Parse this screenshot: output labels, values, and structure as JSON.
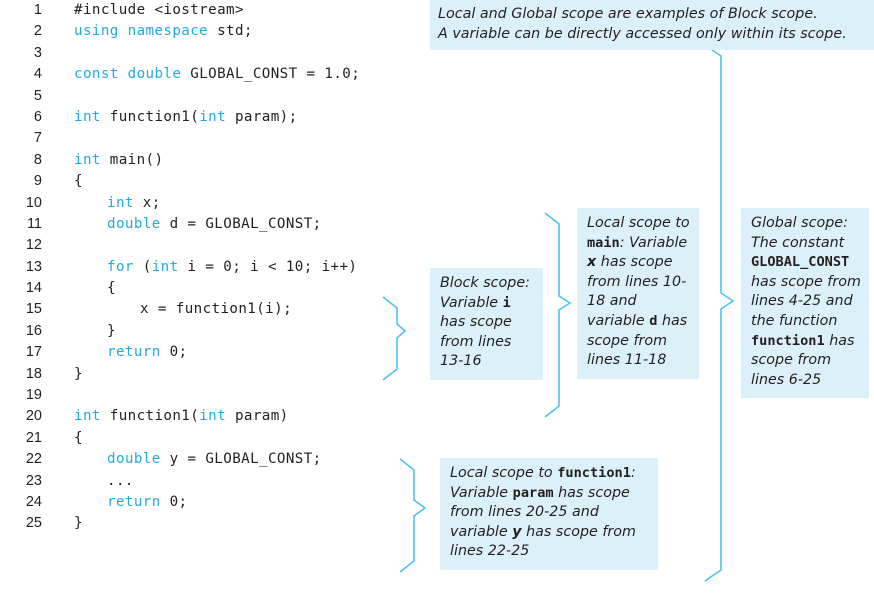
{
  "figure": {
    "type": "annotated-code-listing",
    "language": "C++",
    "background_color": "#ffffff",
    "keyword_color": "#22abe3",
    "text_color": "#231f20",
    "callout_background": "#dcf0fa",
    "connector_color": "#4cc3ef"
  },
  "code": {
    "lines": [
      {
        "number": "1",
        "tokens": [
          {
            "t": "#include <iostream>",
            "k": false
          }
        ],
        "indent": 0
      },
      {
        "number": "2",
        "tokens": [
          {
            "t": "using namespace",
            "k": true
          },
          {
            "t": " std;",
            "k": false
          }
        ],
        "indent": 0
      },
      {
        "number": "3",
        "tokens": [],
        "indent": 0
      },
      {
        "number": "4",
        "tokens": [
          {
            "t": "const double",
            "k": true
          },
          {
            "t": " GLOBAL_CONST = 1.0;",
            "k": false
          }
        ],
        "indent": 0
      },
      {
        "number": "5",
        "tokens": [],
        "indent": 0
      },
      {
        "number": "6",
        "tokens": [
          {
            "t": "int",
            "k": true
          },
          {
            "t": " function1(",
            "k": false
          },
          {
            "t": "int",
            "k": true
          },
          {
            "t": " param);",
            "k": false
          }
        ],
        "indent": 0
      },
      {
        "number": "7",
        "tokens": [],
        "indent": 0
      },
      {
        "number": "8",
        "tokens": [
          {
            "t": "int",
            "k": true
          },
          {
            "t": " main()",
            "k": false
          }
        ],
        "indent": 0
      },
      {
        "number": "9",
        "tokens": [
          {
            "t": "{",
            "k": false
          }
        ],
        "indent": 0
      },
      {
        "number": "10",
        "tokens": [
          {
            "t": "int",
            "k": true
          },
          {
            "t": " x;",
            "k": false
          }
        ],
        "indent": 1
      },
      {
        "number": "11",
        "tokens": [
          {
            "t": "double",
            "k": true
          },
          {
            "t": " d = GLOBAL_CONST;",
            "k": false
          }
        ],
        "indent": 1
      },
      {
        "number": "12",
        "tokens": [],
        "indent": 0
      },
      {
        "number": "13",
        "tokens": [
          {
            "t": "for",
            "k": true
          },
          {
            "t": " (",
            "k": false
          },
          {
            "t": "int",
            "k": true
          },
          {
            "t": " i = 0; i < 10; i++)",
            "k": false
          }
        ],
        "indent": 1
      },
      {
        "number": "14",
        "tokens": [
          {
            "t": "{",
            "k": false
          }
        ],
        "indent": 1
      },
      {
        "number": "15",
        "tokens": [
          {
            "t": "x = function1(i);",
            "k": false
          }
        ],
        "indent": 2
      },
      {
        "number": "16",
        "tokens": [
          {
            "t": "}",
            "k": false
          }
        ],
        "indent": 1
      },
      {
        "number": "17",
        "tokens": [
          {
            "t": "return",
            "k": true
          },
          {
            "t": " 0;",
            "k": false
          }
        ],
        "indent": 1
      },
      {
        "number": "18",
        "tokens": [
          {
            "t": "}",
            "k": false
          }
        ],
        "indent": 0
      },
      {
        "number": "19",
        "tokens": [],
        "indent": 0
      },
      {
        "number": "20",
        "tokens": [
          {
            "t": "int",
            "k": true
          },
          {
            "t": " function1(",
            "k": false
          },
          {
            "t": "int",
            "k": true
          },
          {
            "t": " param)",
            "k": false
          }
        ],
        "indent": 0
      },
      {
        "number": "21",
        "tokens": [
          {
            "t": "{",
            "k": false
          }
        ],
        "indent": 0
      },
      {
        "number": "22",
        "tokens": [
          {
            "t": "double",
            "k": true
          },
          {
            "t": " y = GLOBAL_CONST;",
            "k": false
          }
        ],
        "indent": 1
      },
      {
        "number": "23",
        "tokens": [
          {
            "t": "...",
            "k": false
          }
        ],
        "indent": 1
      },
      {
        "number": "24",
        "tokens": [
          {
            "t": "return",
            "k": true
          },
          {
            "t": " 0;",
            "k": false
          }
        ],
        "indent": 1
      },
      {
        "number": "25",
        "tokens": [
          {
            "t": "}",
            "k": false
          }
        ],
        "indent": 0
      }
    ]
  },
  "callouts": {
    "top_note": {
      "line1": "Local and Global scope are examples of Block scope.",
      "line2": "A variable can be directly accessed only within its scope."
    },
    "block_scope": {
      "title": "Block scope:",
      "body_1": "Variable ",
      "code_1": "i",
      "body_2": " has scope from lines 13-16"
    },
    "main_scope": {
      "title": "Local scope to",
      "code_1": "main",
      "title_2": ":",
      "body_1": "Variable ",
      "code_2": "x",
      "body_2": " has scope from lines 10-18 and variable ",
      "code_3": "d",
      "body_3": " has scope from lines 11-18"
    },
    "global_scope": {
      "title": "Global scope:",
      "body_1": "The constant ",
      "code_1": "GLOBAL_CONST",
      "body_2": " has scope from lines 4-25 and the function ",
      "code_2": "function1",
      "body_3": " has scope from lines 6-25"
    },
    "function1_scope": {
      "title": "Local scope to",
      "code_1": "function1",
      "body_1": ": Variable ",
      "code_2": "param",
      "body_2": " has scope from lines 20-25 and variable ",
      "code_3": "y",
      "body_3": " has scope from lines 22-25"
    }
  }
}
